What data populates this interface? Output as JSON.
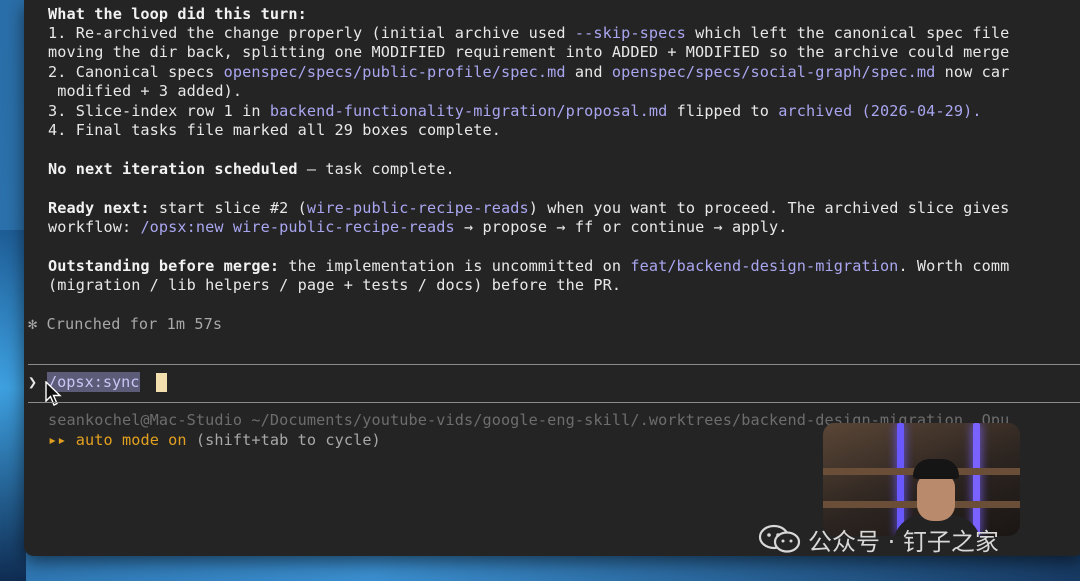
{
  "summary": {
    "heading": "What the loop did this turn:",
    "item1_a": "1. Re-archived the change properly (initial archive used ",
    "item1_flag": "--skip-specs",
    "item1_b": " which left the canonical spec file",
    "item1_line2": "moving the dir back, splitting one MODIFIED requirement into ADDED + MODIFIED so the archive could merge",
    "item2_a": "2. Canonical specs ",
    "item2_path1": "openspec/specs/public-profile/spec.md",
    "item2_and": " and ",
    "item2_path2": "openspec/specs/social-graph/spec.md",
    "item2_b": " now car",
    "item2_line2": " modified + 3 added).",
    "item3_a": "3. Slice-index row 1 in ",
    "item3_path": "backend-functionality-migration/proposal.md",
    "item3_b": " flipped to ",
    "item3_status": "archived",
    "item3_date": " (2026-04-29).",
    "item4": "4. Final tasks file marked all 29 boxes complete."
  },
  "no_next": {
    "bold": "No next iteration scheduled",
    "rest": " — task complete."
  },
  "ready_next": {
    "bold": "Ready next:",
    "a": " start slice #2 (",
    "slice": "wire-public-recipe-reads",
    "b": ") when you want to proceed. The archived slice gives",
    "l2_a": "workflow: ",
    "l2_cmd": "/opsx:new wire-public-recipe-reads",
    "l2_b": " → propose → ff or continue → apply."
  },
  "outstanding": {
    "bold": "Outstanding before merge:",
    "a": " the implementation is uncommitted on ",
    "branch": "feat/backend-design-migration",
    "b": ". Worth comm",
    "l2": "(migration / lib helpers / page + tests / docs) before the PR."
  },
  "status": {
    "glyph": "✻",
    "text": "Crunched for 1m 57s"
  },
  "prompt": {
    "chevron": "❯",
    "value": "/opsx:sync"
  },
  "footer": {
    "path": "seankochel@Mac-Studio ~/Documents/youtube-vids/google-eng-skill/.worktrees/backend-design-migration  Opu",
    "mode_icon": "▸▸",
    "mode_label": "auto mode on",
    "mode_hint": " (shift+tab to cycle)"
  },
  "watermark": {
    "text": "公众号 · 钉子之家"
  },
  "colors": {
    "background": "#242424",
    "text": "#e8e8e8",
    "highlight": "#a9a6f0",
    "accent_orange": "#e3a020",
    "muted": "#6d6d6d"
  }
}
